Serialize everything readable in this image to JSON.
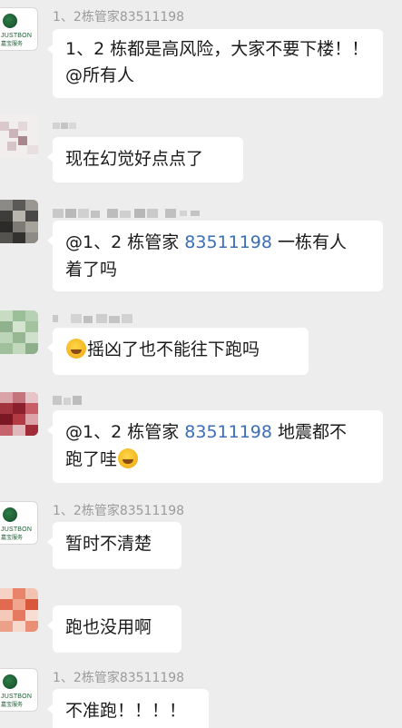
{
  "icons": {
    "org_logo": "property-service-logo",
    "emoji_laugh_cry": "laughing-crying-emoji"
  },
  "org_logo_text": {
    "line1": "JUSTBON",
    "line2": "嘉宝服务"
  },
  "messages": [
    {
      "sender": "1、2栋管家83511198",
      "text": "1、2 栋都是高风险，大家不要下楼！！ @所有人"
    },
    {
      "sender": "",
      "text": "现在幻觉好点点了"
    },
    {
      "sender": "",
      "mention_prefix": "@1、2 栋管家 ",
      "mention_number": "83511198",
      "text_line1_tail": " 一栋有人",
      "text_line2": "着了吗"
    },
    {
      "sender": "",
      "text": "摇凶了也不能往下跑吗"
    },
    {
      "sender": "",
      "mention_prefix": "@1、2 栋管家 ",
      "mention_number": "83511198",
      "text_line1_tail": " 地震都不",
      "text_line2": "跑了哇"
    },
    {
      "sender": "1、2栋管家83511198",
      "text": "暂时不清楚"
    },
    {
      "sender": "",
      "text": "跑也没用啊"
    },
    {
      "sender": "1、2栋管家83511198",
      "text": "不准跑！！！！"
    }
  ]
}
